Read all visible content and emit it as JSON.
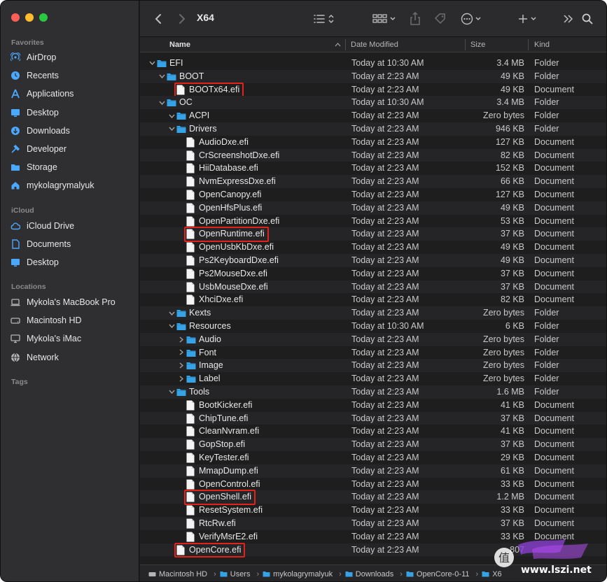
{
  "window": {
    "title": "X64"
  },
  "colors": {
    "folder": "#35a3e6",
    "highlight": "#e0241b",
    "close": "#ff5f57",
    "minimize": "#febc2e",
    "zoom": "#28c840"
  },
  "sidebar": {
    "favorites_label": "Favorites",
    "favorites": [
      {
        "label": "AirDrop",
        "icon": "airdrop-icon"
      },
      {
        "label": "Recents",
        "icon": "clock-icon"
      },
      {
        "label": "Applications",
        "icon": "applications-icon"
      },
      {
        "label": "Desktop",
        "icon": "desktop-icon"
      },
      {
        "label": "Downloads",
        "icon": "downloads-icon"
      },
      {
        "label": "Developer",
        "icon": "hammer-icon"
      },
      {
        "label": "Storage",
        "icon": "folder-icon"
      },
      {
        "label": "mykolagrymalyuk",
        "icon": "home-icon"
      }
    ],
    "icloud_label": "iCloud",
    "icloud": [
      {
        "label": "iCloud Drive",
        "icon": "cloud-icon"
      },
      {
        "label": "Documents",
        "icon": "document-icon"
      },
      {
        "label": "Desktop",
        "icon": "desktop-icon"
      }
    ],
    "locations_label": "Locations",
    "locations": [
      {
        "label": "Mykola's MacBook Pro",
        "icon": "laptop-icon"
      },
      {
        "label": "Macintosh HD",
        "icon": "disk-icon"
      },
      {
        "label": "Mykola's iMac",
        "icon": "imac-icon"
      },
      {
        "label": "Network",
        "icon": "network-icon"
      }
    ],
    "tags_label": "Tags"
  },
  "columns": {
    "name": "Name",
    "date": "Date Modified",
    "size": "Size",
    "kind": "Kind"
  },
  "rows": [
    {
      "name": "EFI",
      "date": "Today at 10:30 AM",
      "size": "3.4 MB",
      "kind": "Folder",
      "depth": 0,
      "type": "folder",
      "expanded": true
    },
    {
      "name": "BOOT",
      "date": "Today at 2:23 AM",
      "size": "49 KB",
      "kind": "Folder",
      "depth": 1,
      "type": "folder",
      "expanded": true
    },
    {
      "name": "BOOTx64.efi",
      "date": "Today at 2:23 AM",
      "size": "49 KB",
      "kind": "Document",
      "depth": 2,
      "type": "file",
      "highlighted": true
    },
    {
      "name": "OC",
      "date": "Today at 10:30 AM",
      "size": "3.4 MB",
      "kind": "Folder",
      "depth": 1,
      "type": "folder",
      "expanded": true
    },
    {
      "name": "ACPI",
      "date": "Today at 2:23 AM",
      "size": "Zero bytes",
      "kind": "Folder",
      "depth": 2,
      "type": "folder",
      "expanded": true
    },
    {
      "name": "Drivers",
      "date": "Today at 2:23 AM",
      "size": "946 KB",
      "kind": "Folder",
      "depth": 2,
      "type": "folder",
      "expanded": true
    },
    {
      "name": "AudioDxe.efi",
      "date": "Today at 2:23 AM",
      "size": "127 KB",
      "kind": "Document",
      "depth": 3,
      "type": "file"
    },
    {
      "name": "CrScreenshotDxe.efi",
      "date": "Today at 2:23 AM",
      "size": "82 KB",
      "kind": "Document",
      "depth": 3,
      "type": "file"
    },
    {
      "name": "HiiDatabase.efi",
      "date": "Today at 2:23 AM",
      "size": "152 KB",
      "kind": "Document",
      "depth": 3,
      "type": "file"
    },
    {
      "name": "NvmExpressDxe.efi",
      "date": "Today at 2:23 AM",
      "size": "66 KB",
      "kind": "Document",
      "depth": 3,
      "type": "file"
    },
    {
      "name": "OpenCanopy.efi",
      "date": "Today at 2:23 AM",
      "size": "127 KB",
      "kind": "Document",
      "depth": 3,
      "type": "file"
    },
    {
      "name": "OpenHfsPlus.efi",
      "date": "Today at 2:23 AM",
      "size": "49 KB",
      "kind": "Document",
      "depth": 3,
      "type": "file"
    },
    {
      "name": "OpenPartitionDxe.efi",
      "date": "Today at 2:23 AM",
      "size": "53 KB",
      "kind": "Document",
      "depth": 3,
      "type": "file"
    },
    {
      "name": "OpenRuntime.efi",
      "date": "Today at 2:23 AM",
      "size": "37 KB",
      "kind": "Document",
      "depth": 3,
      "type": "file",
      "highlighted": true
    },
    {
      "name": "OpenUsbKbDxe.efi",
      "date": "Today at 2:23 AM",
      "size": "49 KB",
      "kind": "Document",
      "depth": 3,
      "type": "file"
    },
    {
      "name": "Ps2KeyboardDxe.efi",
      "date": "Today at 2:23 AM",
      "size": "49 KB",
      "kind": "Document",
      "depth": 3,
      "type": "file"
    },
    {
      "name": "Ps2MouseDxe.efi",
      "date": "Today at 2:23 AM",
      "size": "37 KB",
      "kind": "Document",
      "depth": 3,
      "type": "file"
    },
    {
      "name": "UsbMouseDxe.efi",
      "date": "Today at 2:23 AM",
      "size": "37 KB",
      "kind": "Document",
      "depth": 3,
      "type": "file"
    },
    {
      "name": "XhciDxe.efi",
      "date": "Today at 2:23 AM",
      "size": "82 KB",
      "kind": "Document",
      "depth": 3,
      "type": "file"
    },
    {
      "name": "Kexts",
      "date": "Today at 2:23 AM",
      "size": "Zero bytes",
      "kind": "Folder",
      "depth": 2,
      "type": "folder",
      "expanded": true
    },
    {
      "name": "Resources",
      "date": "Today at 10:30 AM",
      "size": "6 KB",
      "kind": "Folder",
      "depth": 2,
      "type": "folder",
      "expanded": true
    },
    {
      "name": "Audio",
      "date": "Today at 2:23 AM",
      "size": "Zero bytes",
      "kind": "Folder",
      "depth": 3,
      "type": "folder",
      "expanded": false
    },
    {
      "name": "Font",
      "date": "Today at 2:23 AM",
      "size": "Zero bytes",
      "kind": "Folder",
      "depth": 3,
      "type": "folder",
      "expanded": false
    },
    {
      "name": "Image",
      "date": "Today at 2:23 AM",
      "size": "Zero bytes",
      "kind": "Folder",
      "depth": 3,
      "type": "folder",
      "expanded": false
    },
    {
      "name": "Label",
      "date": "Today at 2:23 AM",
      "size": "Zero bytes",
      "kind": "Folder",
      "depth": 3,
      "type": "folder",
      "expanded": false
    },
    {
      "name": "Tools",
      "date": "Today at 2:23 AM",
      "size": "1.6 MB",
      "kind": "Folder",
      "depth": 2,
      "type": "folder",
      "expanded": true
    },
    {
      "name": "BootKicker.efi",
      "date": "Today at 2:23 AM",
      "size": "41 KB",
      "kind": "Document",
      "depth": 3,
      "type": "file"
    },
    {
      "name": "ChipTune.efi",
      "date": "Today at 2:23 AM",
      "size": "37 KB",
      "kind": "Document",
      "depth": 3,
      "type": "file"
    },
    {
      "name": "CleanNvram.efi",
      "date": "Today at 2:23 AM",
      "size": "41 KB",
      "kind": "Document",
      "depth": 3,
      "type": "file"
    },
    {
      "name": "GopStop.efi",
      "date": "Today at 2:23 AM",
      "size": "37 KB",
      "kind": "Document",
      "depth": 3,
      "type": "file"
    },
    {
      "name": "KeyTester.efi",
      "date": "Today at 2:23 AM",
      "size": "29 KB",
      "kind": "Document",
      "depth": 3,
      "type": "file"
    },
    {
      "name": "MmapDump.efi",
      "date": "Today at 2:23 AM",
      "size": "61 KB",
      "kind": "Document",
      "depth": 3,
      "type": "file"
    },
    {
      "name": "OpenControl.efi",
      "date": "Today at 2:23 AM",
      "size": "33 KB",
      "kind": "Document",
      "depth": 3,
      "type": "file"
    },
    {
      "name": "OpenShell.efi",
      "date": "Today at 2:23 AM",
      "size": "1.2 MB",
      "kind": "Document",
      "depth": 3,
      "type": "file",
      "highlighted": true
    },
    {
      "name": "ResetSystem.efi",
      "date": "Today at 2:23 AM",
      "size": "33 KB",
      "kind": "Document",
      "depth": 3,
      "type": "file"
    },
    {
      "name": "RtcRw.efi",
      "date": "Today at 2:23 AM",
      "size": "37 KB",
      "kind": "Document",
      "depth": 3,
      "type": "file"
    },
    {
      "name": "VerifyMsrE2.efi",
      "date": "Today at 2:23 AM",
      "size": "33 KB",
      "kind": "Document",
      "depth": 3,
      "type": "file"
    },
    {
      "name": "OpenCore.efi",
      "date": "Today at 2:23 AM",
      "size": "807",
      "kind": "",
      "depth": 2,
      "type": "file",
      "highlighted": true
    }
  ],
  "pathbar": [
    "Macintosh HD",
    "Users",
    "mykolagrymalyuk",
    "Downloads",
    "OpenCore-0-11",
    "X6"
  ],
  "watermark": {
    "line1": "值",
    "line2": "www.lszi.net"
  }
}
